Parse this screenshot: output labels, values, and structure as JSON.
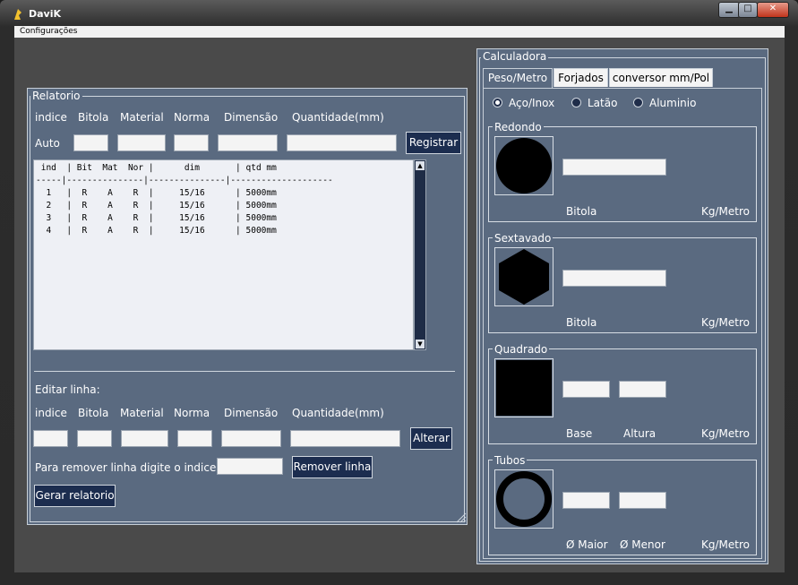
{
  "window": {
    "title": "DaviK"
  },
  "menu": {
    "items": [
      "Configurações"
    ]
  },
  "relatorio": {
    "legend": "Relatorio",
    "headers": [
      "indice",
      "Bitola",
      "Material",
      "Norma",
      "Dimensão",
      "Quantidade(mm)"
    ],
    "auto_label": "Auto",
    "registrar_label": "Registrar",
    "report_lines": [
      " ind  | Bit  Mat  Nor |      dim       | qtd mm",
      "-----|---------------|---------------|--------------------",
      "  1   |  R    A    R  |     15/16      | 5000mm",
      "  2   |  R    A    R  |     15/16      | 5000mm",
      "  3   |  R    A    R  |     15/16      | 5000mm",
      "  4   |  R    A    R  |     15/16      | 5000mm"
    ],
    "editar_label": "Editar linha:",
    "alterar_label": "Alterar",
    "remover_prompt": "Para remover linha digite o indice",
    "remover_label": "Remover linha",
    "gerar_label": "Gerar relatorio"
  },
  "calculadora": {
    "legend": "Calculadora",
    "tabs": [
      "Peso/Metro",
      "Forjados",
      "conversor mm/Pol"
    ],
    "active_tab": "Peso/Metro",
    "materials": [
      "Aço/Inox",
      "Latão",
      "Aluminio"
    ],
    "selected_material": "Aço/Inox",
    "sections": {
      "redondo": {
        "legend": "Redondo",
        "labels": [
          "Bitola",
          "Kg/Metro"
        ]
      },
      "sextavado": {
        "legend": "Sextavado",
        "labels": [
          "Bitola",
          "Kg/Metro"
        ]
      },
      "quadrado": {
        "legend": "Quadrado",
        "labels": [
          "Base",
          "Altura",
          "Kg/Metro"
        ]
      },
      "tubos": {
        "legend": "Tubos",
        "labels": [
          "Ø Maior",
          "Ø Menor",
          "Kg/Metro"
        ]
      }
    }
  },
  "colors": {
    "panel": "#5a6a80",
    "button": "#1c2d4f",
    "frame": "#2a2a2a"
  }
}
